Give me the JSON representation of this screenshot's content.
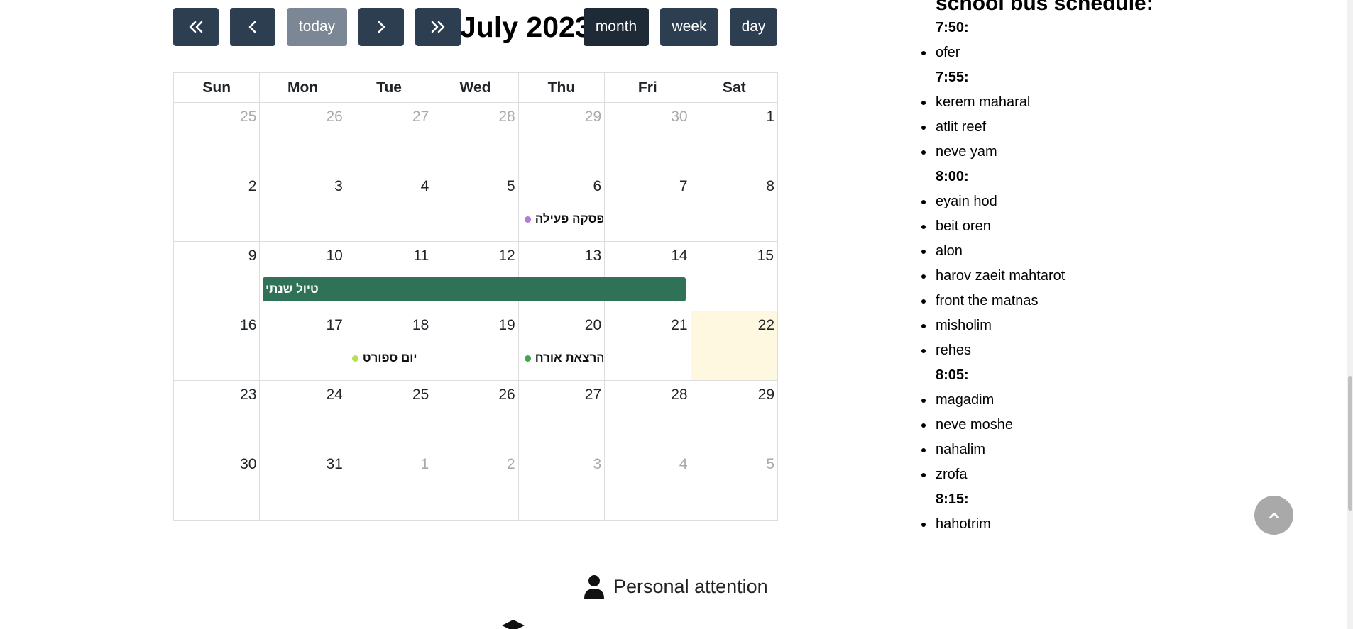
{
  "toolbar": {
    "prev_year_icon": "double-chevron-left",
    "prev_icon": "chevron-left",
    "today_label": "today",
    "next_icon": "chevron-right",
    "next_year_icon": "double-chevron-right",
    "title": "July 2023",
    "views": {
      "month": "month",
      "week": "week",
      "day": "day"
    },
    "active_view": "month"
  },
  "calendar": {
    "weekdays": [
      "Sun",
      "Mon",
      "Tue",
      "Wed",
      "Thu",
      "Fri",
      "Sat"
    ],
    "weeks": [
      [
        "25",
        "26",
        "27",
        "28",
        "29",
        "30",
        "1"
      ],
      [
        "2",
        "3",
        "4",
        "5",
        "6",
        "7",
        "8"
      ],
      [
        "9",
        "10",
        "11",
        "12",
        "13",
        "14",
        "15"
      ],
      [
        "16",
        "17",
        "18",
        "19",
        "20",
        "21",
        "22"
      ],
      [
        "23",
        "24",
        "25",
        "26",
        "27",
        "28",
        "29"
      ],
      [
        "30",
        "31",
        "1",
        "2",
        "3",
        "4",
        "5"
      ]
    ],
    "events": {
      "hafsaka": {
        "title": "הפסקה פעילה",
        "color": "#b57ad6"
      },
      "trip": {
        "title": "טיול שנתי",
        "color": "#2f7258"
      },
      "sport": {
        "title": "יום ספורט",
        "color": "#b5e14a"
      },
      "lecture": {
        "title": "הרצאת אורח",
        "color": "#3ea84a"
      }
    },
    "today_color": "#fdf8df"
  },
  "bus_schedule": {
    "title": "school bus schedule:",
    "slots": [
      {
        "time": "7:50:",
        "stops": [
          "ofer"
        ]
      },
      {
        "time": "7:55:",
        "stops": [
          "kerem maharal",
          "atlit reef",
          "neve yam"
        ]
      },
      {
        "time": "8:00:",
        "stops": [
          "eyain hod",
          "beit oren",
          "alon",
          "harov zaeit mahtarot",
          "front the matnas",
          "misholim",
          "rehes"
        ]
      },
      {
        "time": "8:05:",
        "stops": [
          "magadim",
          "neve moshe",
          "nahalim",
          "zrofa"
        ]
      },
      {
        "time": "8:15:",
        "stops": [
          "hahotrim"
        ]
      }
    ]
  },
  "features": {
    "personal_attention": "Personal attention",
    "personal_icon": "person-icon",
    "second_icon": "graduation-cap-icon"
  },
  "scroll_top_icon": "chevron-up-icon",
  "colors": {
    "button": "#2c3e50",
    "button_active": "#1e2b37",
    "button_disabled": "#7b8794",
    "scroll_top": "#a9a9a9"
  }
}
